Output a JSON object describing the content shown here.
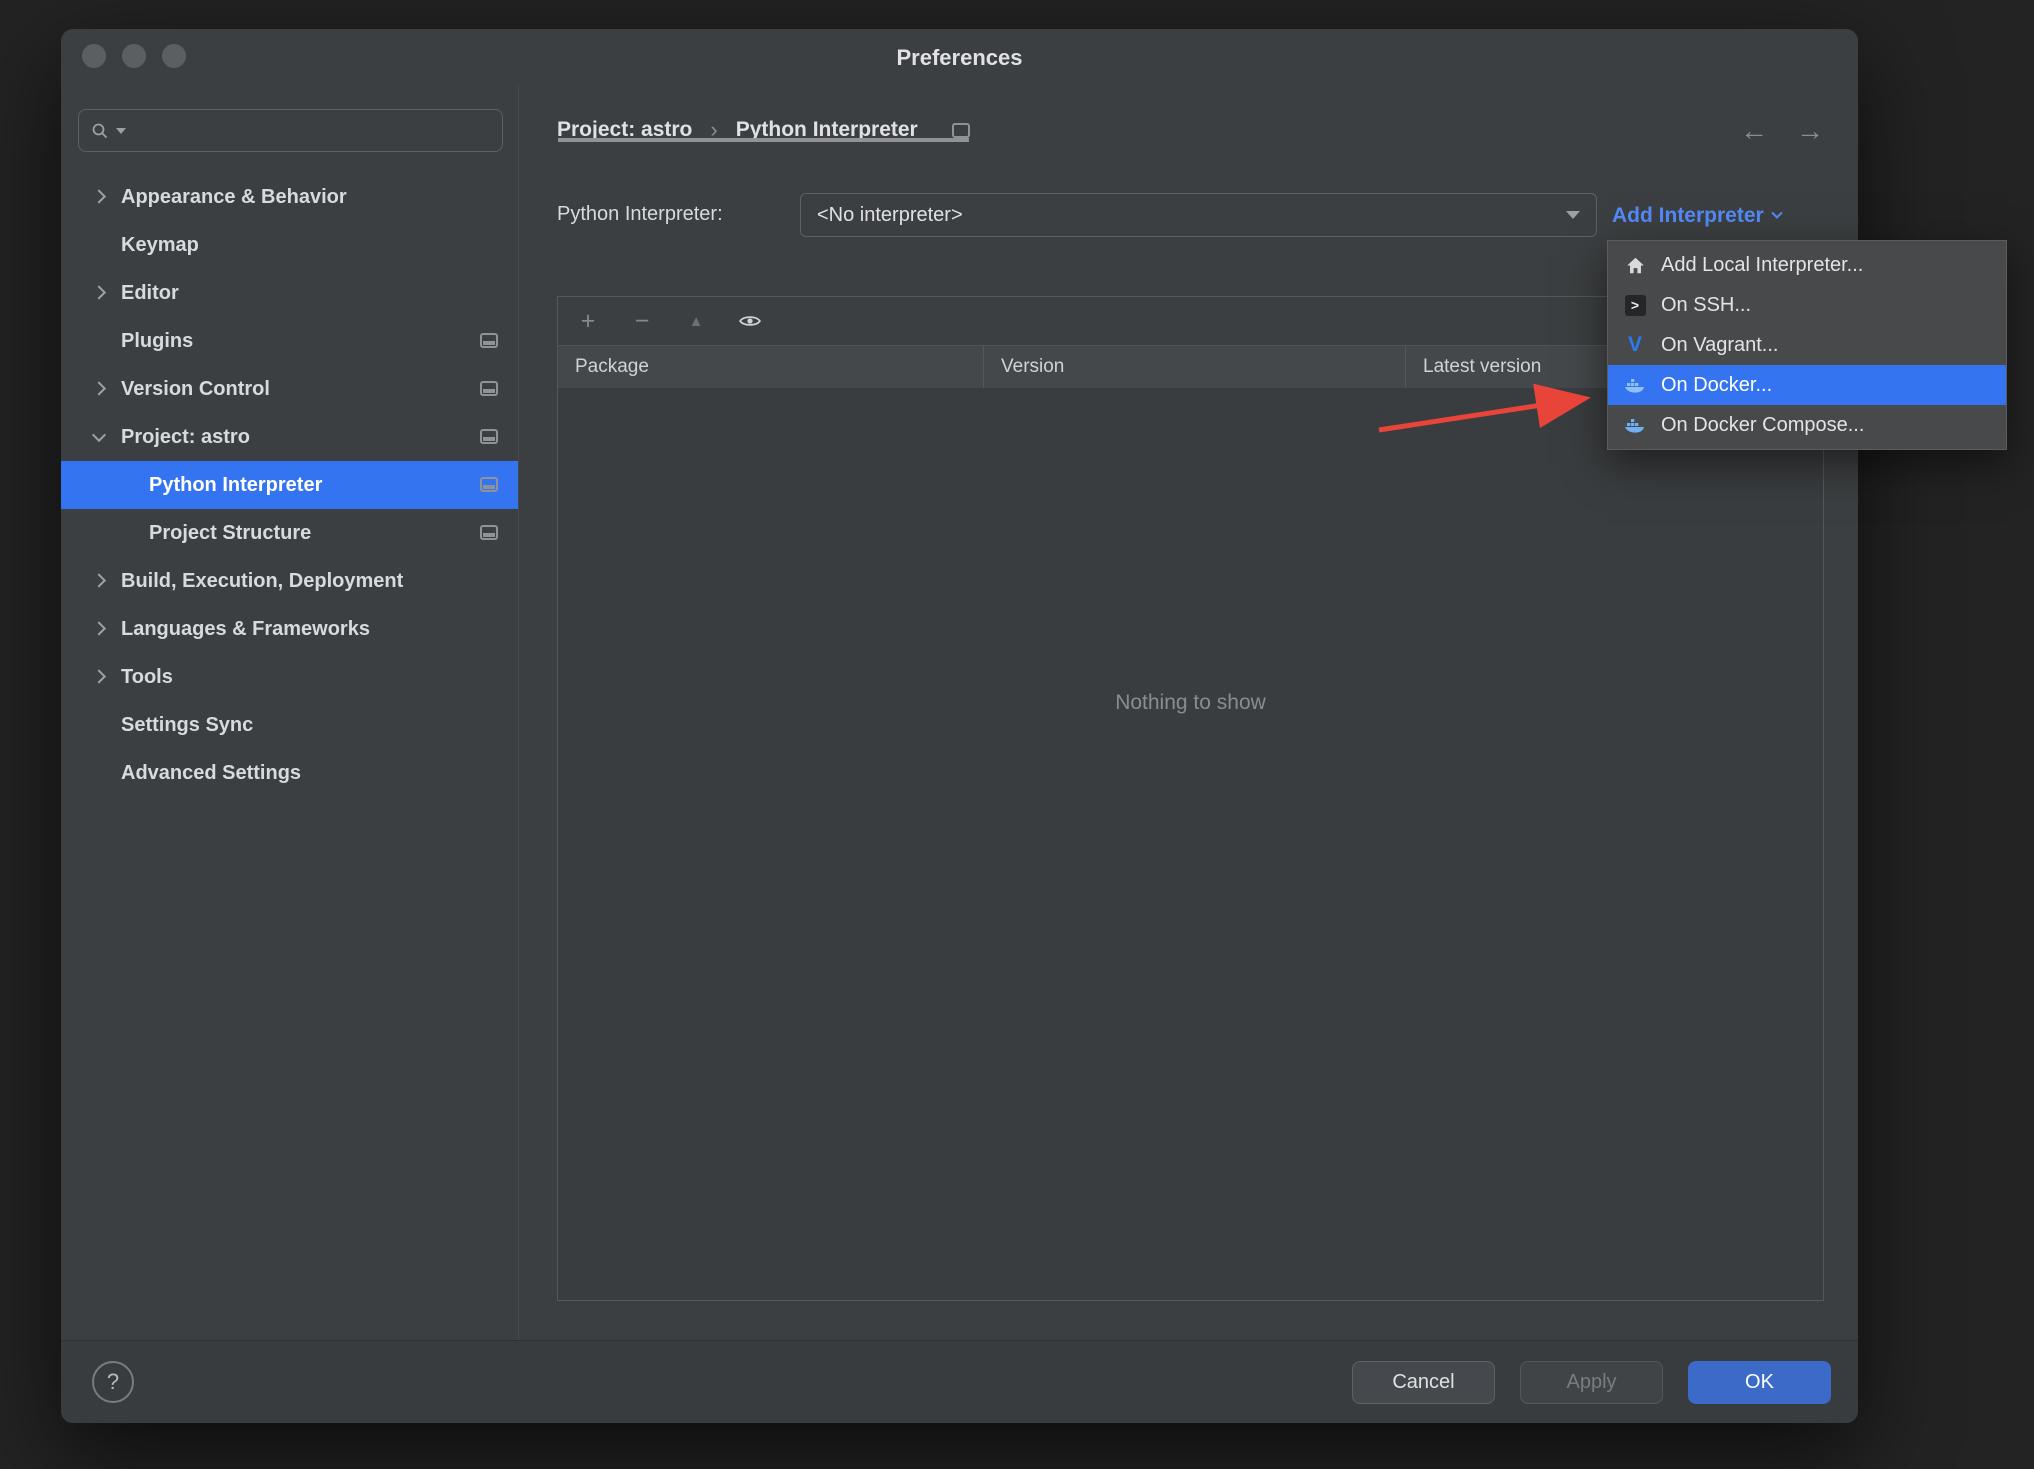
{
  "window_title": "Preferences",
  "sidebar": {
    "items": [
      {
        "label": "Appearance & Behavior"
      },
      {
        "label": "Keymap"
      },
      {
        "label": "Editor"
      },
      {
        "label": "Plugins"
      },
      {
        "label": "Version Control"
      },
      {
        "label": "Project: astro"
      },
      {
        "label": "Python Interpreter"
      },
      {
        "label": "Project Structure"
      },
      {
        "label": "Build, Execution, Deployment"
      },
      {
        "label": "Languages & Frameworks"
      },
      {
        "label": "Tools"
      },
      {
        "label": "Settings Sync"
      },
      {
        "label": "Advanced Settings"
      }
    ]
  },
  "breadcrumb": {
    "project": "Project: astro",
    "separator": "›",
    "page": "Python Interpreter"
  },
  "nav": {
    "back": "←",
    "forward": "→"
  },
  "interpreter": {
    "label": "Python Interpreter:",
    "value": "<No interpreter>",
    "add_link": "Add Interpreter"
  },
  "menu": {
    "items": [
      {
        "label": "Add Local Interpreter...",
        "icon": "home-icon"
      },
      {
        "label": "On SSH...",
        "icon": "ssh-icon"
      },
      {
        "label": "On Vagrant...",
        "icon": "vagrant-icon"
      },
      {
        "label": "On Docker...",
        "icon": "docker-icon",
        "selected": true
      },
      {
        "label": "On Docker Compose...",
        "icon": "docker-icon"
      }
    ]
  },
  "toolbar": {
    "add": "+",
    "remove": "−",
    "up": "▲"
  },
  "table": {
    "columns": [
      "Package",
      "Version",
      "Latest version"
    ],
    "rows": [],
    "empty": "Nothing to show"
  },
  "footer": {
    "help": "?",
    "cancel": "Cancel",
    "apply": "Apply",
    "ok": "OK"
  },
  "colors": {
    "selection": "#3574f0",
    "link": "#548af7",
    "ok_button": "#3b6ac9",
    "annotation_arrow": "#e8443a",
    "table_header": "#45484a"
  }
}
